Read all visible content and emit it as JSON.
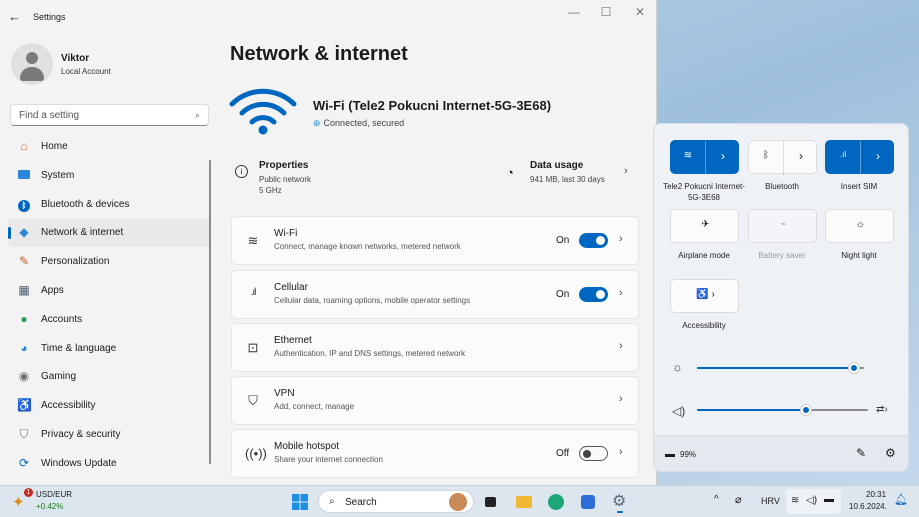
{
  "window": {
    "title": "Settings",
    "back_icon": "back-arrow-icon",
    "controls": [
      "minimize-icon",
      "maximize-icon",
      "close-icon"
    ]
  },
  "profile": {
    "name": "Viktor",
    "account": "Local Account"
  },
  "search": {
    "placeholder": "Find a setting"
  },
  "nav": {
    "items": [
      {
        "label": "Home",
        "icon": "home-icon"
      },
      {
        "label": "System",
        "icon": "system-icon"
      },
      {
        "label": "Bluetooth & devices",
        "icon": "bluetooth-icon"
      },
      {
        "label": "Network & internet",
        "icon": "network-icon",
        "active": true
      },
      {
        "label": "Personalization",
        "icon": "brush-icon"
      },
      {
        "label": "Apps",
        "icon": "apps-icon"
      },
      {
        "label": "Accounts",
        "icon": "accounts-icon"
      },
      {
        "label": "Time & language",
        "icon": "globe-icon"
      },
      {
        "label": "Gaming",
        "icon": "gamepad-icon"
      },
      {
        "label": "Accessibility",
        "icon": "accessibility-icon"
      },
      {
        "label": "Privacy & security",
        "icon": "shield-icon"
      },
      {
        "label": "Windows Update",
        "icon": "update-icon"
      }
    ]
  },
  "main": {
    "title": "Network & internet",
    "wifi": {
      "name": "Wi-Fi (Tele2 Pokucni Internet-5G-3E68)",
      "status": "Connected, secured"
    },
    "properties": {
      "title": "Properties",
      "line1": "Public network",
      "line2": "5 GHz"
    },
    "data_usage": {
      "title": "Data usage",
      "subtitle": "941 MB, last 30 days"
    },
    "cards": [
      {
        "title": "Wi-Fi",
        "subtitle": "Connect, manage known networks, metered network",
        "state": "On",
        "toggle": "on",
        "icon": "wifi-icon"
      },
      {
        "title": "Cellular",
        "subtitle": "Cellular data, roaming options, mobile operator settings",
        "state": "On",
        "toggle": "on",
        "icon": "signal-bars-icon"
      },
      {
        "title": "Ethernet",
        "subtitle": "Authentication, IP and DNS settings, metered network",
        "icon": "ethernet-icon"
      },
      {
        "title": "VPN",
        "subtitle": "Add, connect, manage",
        "icon": "vpn-shield-icon"
      },
      {
        "title": "Mobile hotspot",
        "subtitle": "Share your internet connection",
        "state": "Off",
        "toggle": "off",
        "icon": "hotspot-icon"
      }
    ]
  },
  "quick_settings": {
    "tiles": [
      {
        "label": "Tele2 Pokucni Internet-5G-3E68",
        "active": true,
        "icon": "wifi-icon"
      },
      {
        "label": "Bluetooth",
        "active": false,
        "icon": "bluetooth-icon"
      },
      {
        "label": "Insert SIM",
        "active": true,
        "icon": "signal-bars-icon"
      },
      {
        "label": "Airplane mode",
        "active": false,
        "icon": "airplane-icon"
      },
      {
        "label": "Battery saver",
        "active": false,
        "disabled": true,
        "icon": "battery-saver-icon"
      },
      {
        "label": "Night light",
        "active": false,
        "icon": "night-light-icon"
      },
      {
        "label": "Accessibility",
        "active": false,
        "icon": "accessibility-icon"
      }
    ],
    "brightness": 0.94,
    "volume": 0.64,
    "battery": "99%"
  },
  "taskbar": {
    "widget_title": "USD/EUR",
    "widget_value": "+0.42%",
    "widget_badge": "1",
    "search_label": "Search",
    "language": "HRV",
    "time": "20:31",
    "date": "10.6.2024."
  },
  "colors": {
    "accent": "#0067c0",
    "positive": "#107c10"
  }
}
